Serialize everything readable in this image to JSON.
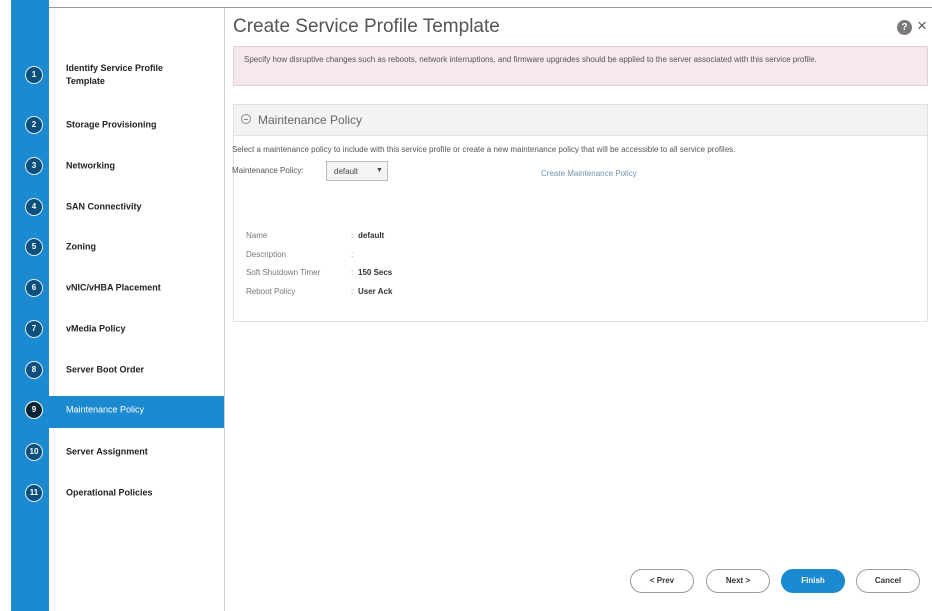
{
  "header": {
    "title": "Create Service Profile Template",
    "help_glyph": "?",
    "close_glyph": "×"
  },
  "banner": {
    "text": "Specify how disruptive changes such as reboots, network interruptions, and firmware upgrades should be applied to the server associated with this service profile."
  },
  "steps": [
    {
      "num": "1",
      "label": "Identify Service Profile Template"
    },
    {
      "num": "2",
      "label": "Storage Provisioning"
    },
    {
      "num": "3",
      "label": "Networking"
    },
    {
      "num": "4",
      "label": "SAN Connectivity"
    },
    {
      "num": "5",
      "label": "Zoning"
    },
    {
      "num": "6",
      "label": "vNIC/vHBA Placement"
    },
    {
      "num": "7",
      "label": "vMedia Policy"
    },
    {
      "num": "8",
      "label": "Server Boot Order"
    },
    {
      "num": "9",
      "label": "Maintenance Policy"
    },
    {
      "num": "10",
      "label": "Server Assignment"
    },
    {
      "num": "11",
      "label": "Operational Policies"
    }
  ],
  "active_step": 9,
  "panel": {
    "title": "Maintenance Policy",
    "description": "Select a maintenance policy to include with this service profile or create a new maintenance policy that will be accessible to all service profiles.",
    "policy_label": "Maintenance Policy:",
    "policy_value": "default",
    "create_link": "Create Maintenance Policy",
    "properties": [
      {
        "key": "Name",
        "value": "default"
      },
      {
        "key": "Description",
        "value": ""
      },
      {
        "key": "Soft Shutdown Timer",
        "value": "150 Secs"
      },
      {
        "key": "Reboot Policy",
        "value": "User Ack"
      }
    ]
  },
  "footer": {
    "prev": "< Prev",
    "next": "Next >",
    "finish": "Finish",
    "cancel": "Cancel"
  },
  "colors": {
    "accent": "#1b8ad0",
    "step_circle": "#0b4f7c",
    "banner_bg": "#f6e9ec"
  },
  "icons": {
    "help": "help-icon",
    "close": "close-icon",
    "collapse": "collapse-icon",
    "dropdown": "chevron-down-icon"
  }
}
